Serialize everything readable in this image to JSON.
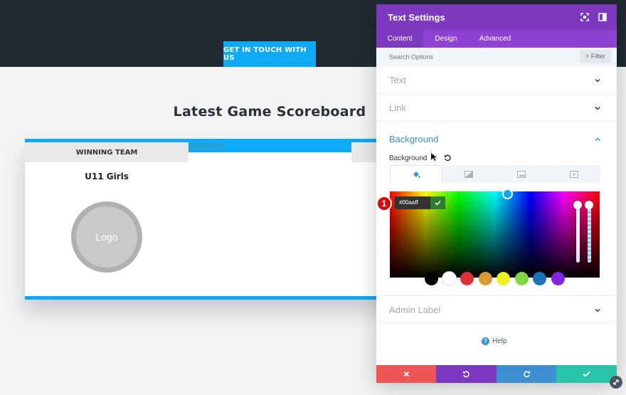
{
  "page": {
    "cta_label": "GET IN TOUCH WITH US",
    "title": "Latest Game Scoreboard",
    "column_header": "WINNING TEAM",
    "date": "12/10/2018",
    "team_name": "U11 Girls",
    "logo_text": "Logo"
  },
  "panel": {
    "title": "Text Settings",
    "tabs": [
      {
        "label": "Content",
        "active": true
      },
      {
        "label": "Design",
        "active": false
      },
      {
        "label": "Advanced",
        "active": false
      }
    ],
    "search": {
      "placeholder": "Search Options",
      "value": ""
    },
    "filter_label": "Filter",
    "sections": {
      "text": "Text",
      "link": "Link",
      "background": "Background",
      "admin_label": "Admin Label"
    },
    "background": {
      "field_label": "Background",
      "tab_icons": [
        "paint-bucket-icon",
        "gradient-icon",
        "image-icon",
        "video-icon"
      ],
      "hex_value": "#00aaff",
      "swatches": [
        "#000000",
        "#ffffff",
        "#dd3333",
        "#dd9933",
        "#eeee22",
        "#81d742",
        "#1e73be",
        "#8224e3"
      ]
    },
    "help_label": "Help",
    "annotation_number": "1"
  },
  "colors": {
    "accent_blue": "#0eaaf5",
    "header_purple": "#7d3ac1",
    "tabs_purple": "#8e42d3",
    "footer": {
      "cancel": "#ef5555",
      "undo": "#7d3ac1",
      "redo": "#3d8fd1",
      "save": "#29c4a9"
    }
  }
}
